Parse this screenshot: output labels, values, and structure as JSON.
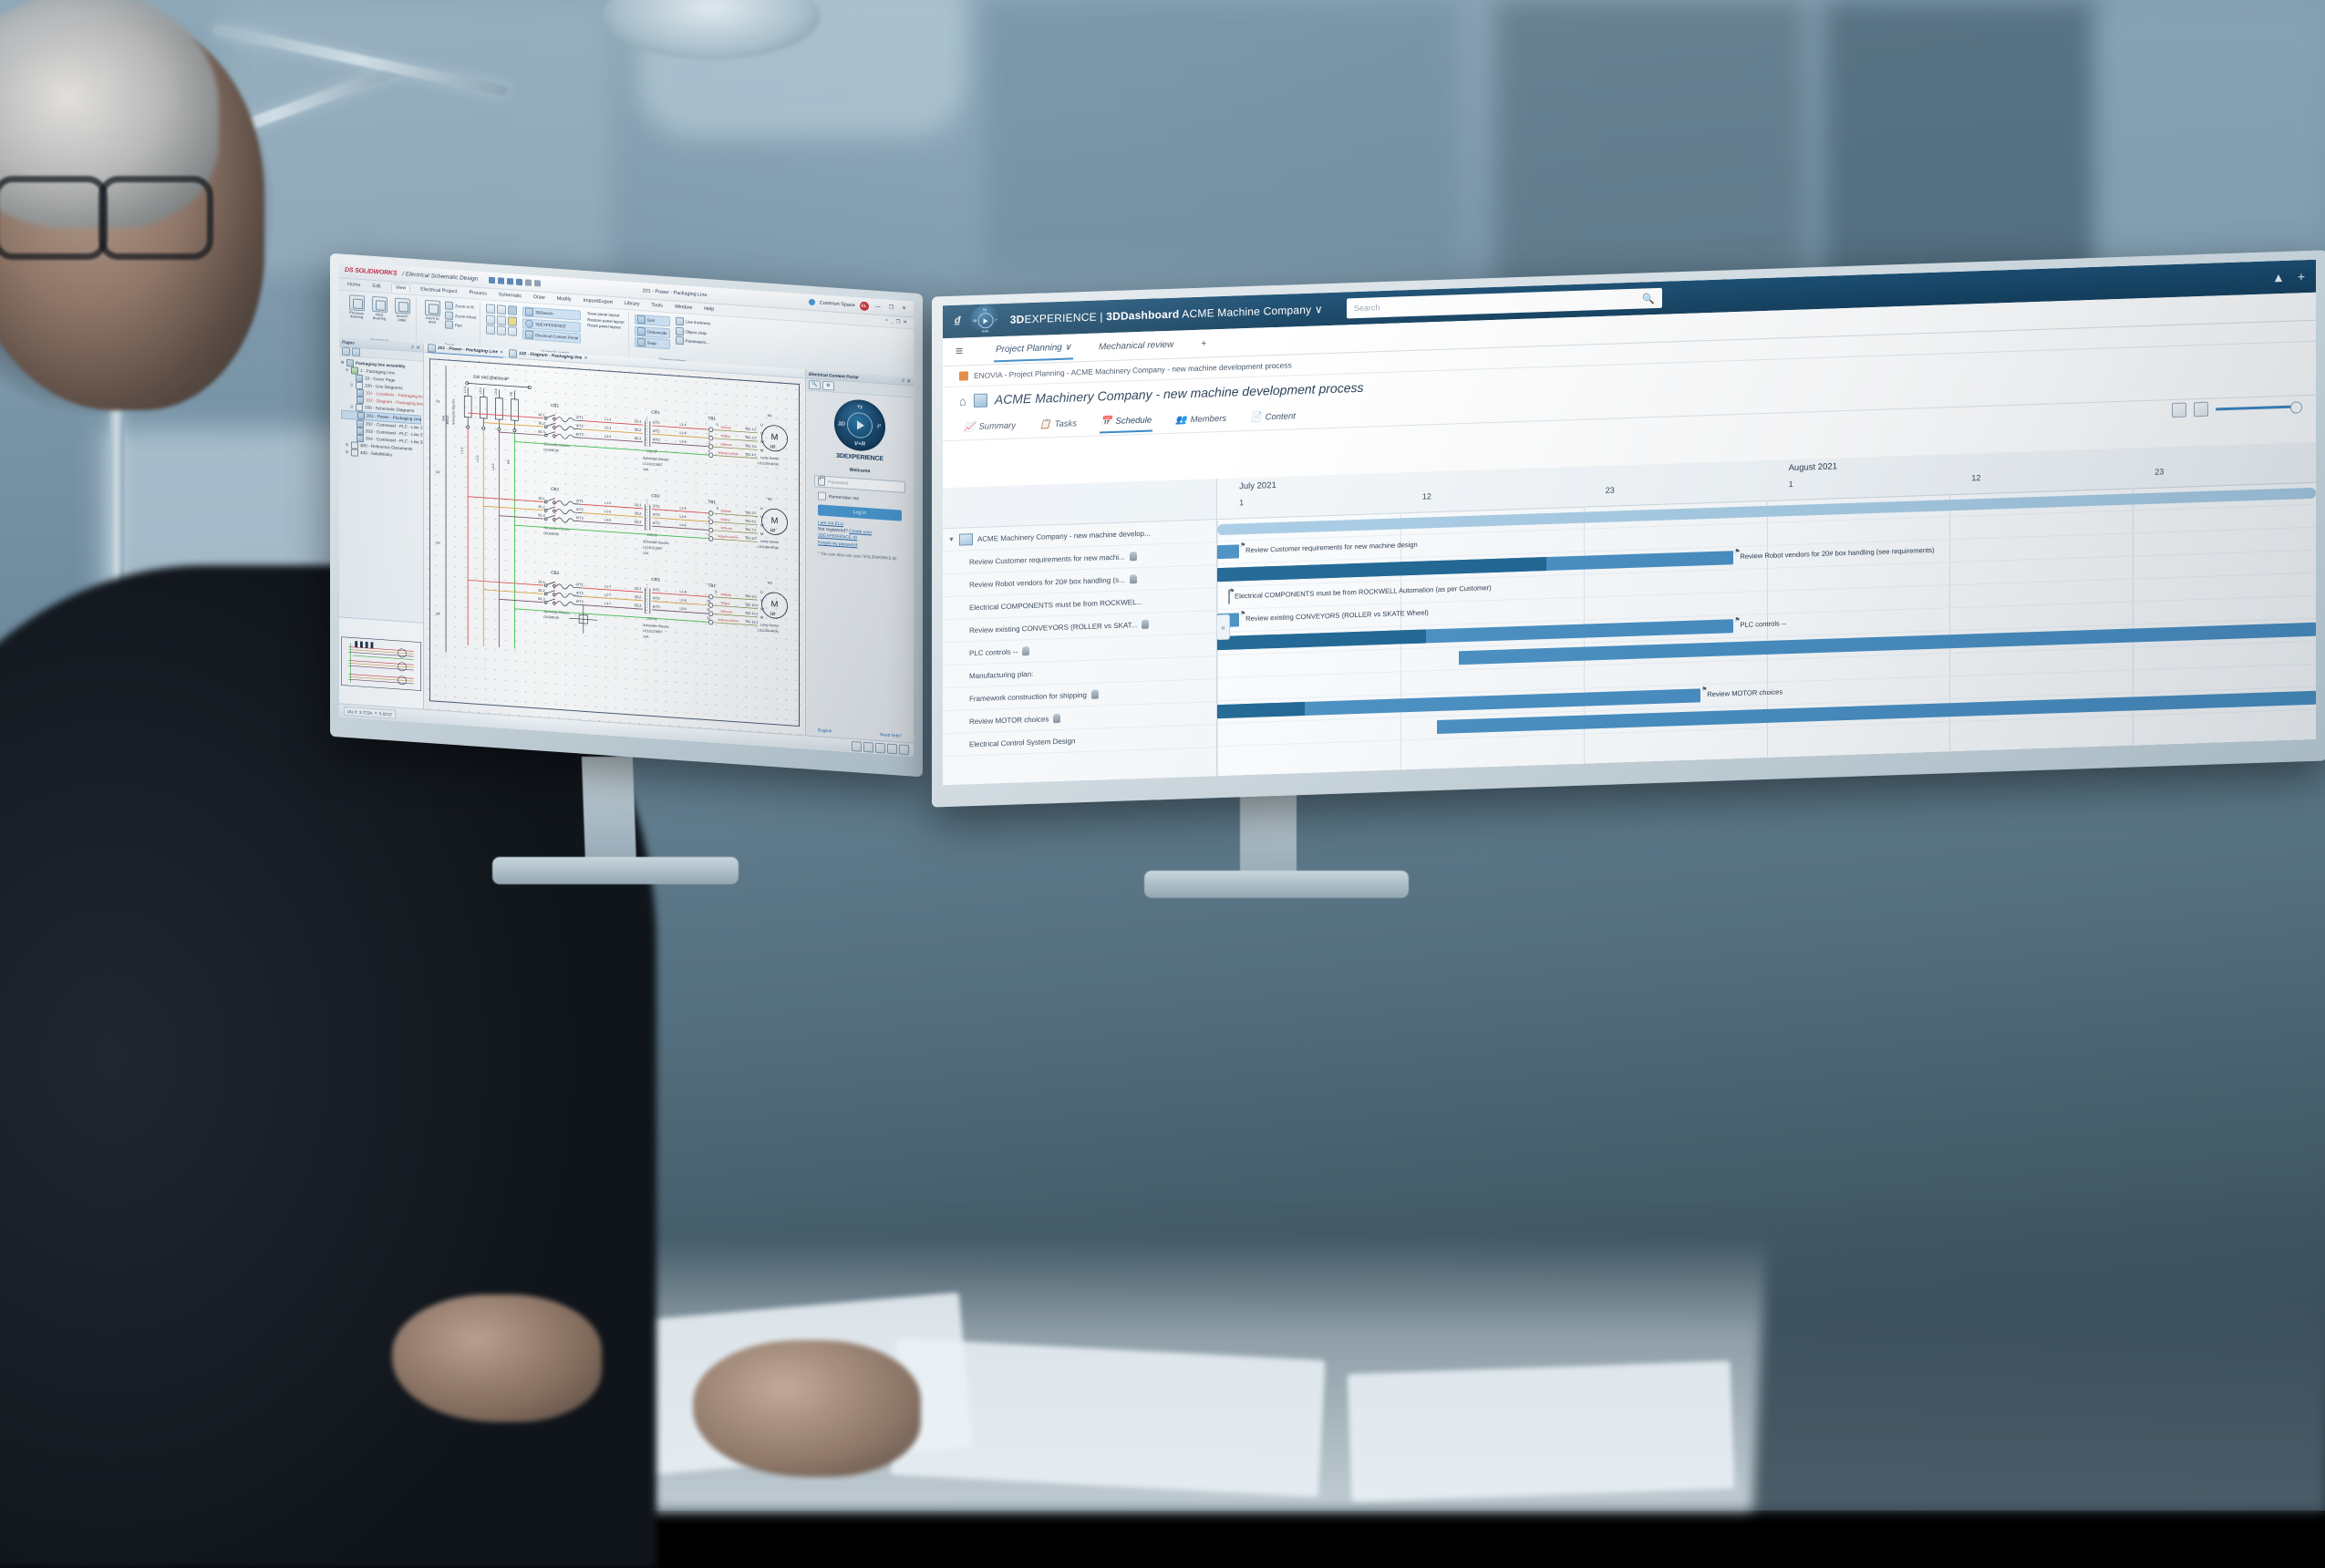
{
  "solidworks": {
    "brand": "SOLIDWORKS",
    "brand_mark": "DS",
    "product": "Electrical Schematic Design",
    "document_title": "201 - Power - Packaging Line",
    "common_space": "Common Space",
    "avatar_initials": "EL",
    "window_buttons": [
      "—",
      "❐",
      "✕"
    ],
    "menu": [
      "Home",
      "Edit",
      "View",
      "Electrical Project",
      "Process",
      "Schematic",
      "Draw",
      "Modify",
      "Import/Export",
      "Library",
      "Tools",
      "Window",
      "Help"
    ],
    "menu_active": "View",
    "ribbon_groups": [
      {
        "label": "Navigation",
        "big_buttons": [
          {
            "icon": "previous-drawing-icon",
            "line1": "Previous",
            "line2": "drawing"
          },
          {
            "icon": "next-drawing-icon",
            "line1": "Next",
            "line2": "drawing"
          },
          {
            "icon": "search-page-icon",
            "line1": "Search",
            "line2": "page"
          }
        ]
      },
      {
        "label": "Zoom",
        "big_buttons": [
          {
            "icon": "zoom-to-area-icon",
            "line1": "Zoom to",
            "line2": "area"
          }
        ],
        "small_buttons": [
          {
            "icon": "zoom-fit-icon",
            "label": "Zoom to fit"
          },
          {
            "icon": "zoom-inout-icon",
            "label": "Zoom in/out"
          },
          {
            "icon": "pan-icon",
            "label": "Pan"
          }
        ]
      },
      {
        "label": "Dockable panels",
        "toggle_icons": [
          "panel-1-icon",
          "panel-2-icon",
          "panel-3-icon",
          "panel-4-icon",
          "panel-5-icon",
          "panel-6-icon",
          "link-icon",
          "favorite-icon",
          "report-icon"
        ],
        "small_buttons": [
          {
            "icon": "search-icon",
            "label": "3DSearch",
            "highlight": true
          },
          {
            "icon": "globe-icon",
            "label": "3DEXPERIENCE",
            "highlight": true
          },
          {
            "icon": "portal-icon",
            "label": "Electrical Content Portal",
            "highlight": true
          }
        ],
        "text_buttons": [
          "Save panel layout",
          "Restore panel layout",
          "Reset panel layout"
        ]
      },
      {
        "label": "Drawing options",
        "small_buttons": [
          {
            "icon": "grid-icon",
            "label": "Grid",
            "highlight": true
          },
          {
            "icon": "orthomode-icon",
            "label": "Orthomode",
            "highlight": true
          },
          {
            "icon": "snap-icon",
            "label": "Snap",
            "highlight": true
          },
          {
            "icon": "line-thickness-icon",
            "label": "Line thickness"
          },
          {
            "icon": "object-snap-icon",
            "label": "Object snap"
          },
          {
            "icon": "parameters-icon",
            "label": "Parameters..."
          }
        ]
      }
    ],
    "pages_panel": {
      "title": "Pages",
      "pin_buttons": "⌷ ✕",
      "tree": [
        {
          "depth": 0,
          "expander": "⊟",
          "icon": "assembly-icon",
          "label": "Packaging line assembly",
          "style": "bold"
        },
        {
          "depth": 1,
          "expander": "⊟",
          "icon": "book-icon",
          "label": "1 - Packaging Line",
          "style": "normal"
        },
        {
          "depth": 2,
          "expander": "",
          "icon": "page-icon",
          "label": "10 - Cover Page",
          "style": "normal"
        },
        {
          "depth": 2,
          "expander": "⊟",
          "icon": "folder-icon",
          "label": "100 - Line Diagrams",
          "style": "normal"
        },
        {
          "depth": 3,
          "expander": "",
          "icon": "page-icon",
          "label": "101 - Locations - Packaging line",
          "style": "red"
        },
        {
          "depth": 3,
          "expander": "",
          "icon": "page-icon",
          "label": "102 - Diagram - Packaging line",
          "style": "red"
        },
        {
          "depth": 2,
          "expander": "⊟",
          "icon": "folder-icon",
          "label": "200 - Schematic Diagrams",
          "style": "normal"
        },
        {
          "depth": 3,
          "expander": "",
          "icon": "page-icon",
          "label": "201 - Power - Packaging Line",
          "style": "selected"
        },
        {
          "depth": 3,
          "expander": "",
          "icon": "page-icon",
          "label": "202 - Command - PLC - Line 1",
          "style": "normal"
        },
        {
          "depth": 3,
          "expander": "",
          "icon": "page-icon",
          "label": "203 - Command - PLC - Line 2",
          "style": "normal"
        },
        {
          "depth": 3,
          "expander": "",
          "icon": "page-icon",
          "label": "204 - Command - PLC - Line 3",
          "style": "normal"
        },
        {
          "depth": 1,
          "expander": "⊞",
          "icon": "folder-icon",
          "label": "300 - Reference Documents",
          "style": "normal"
        },
        {
          "depth": 1,
          "expander": "⊞",
          "icon": "folder-icon",
          "label": "400 - SolidWorks",
          "style": "normal"
        }
      ]
    },
    "document_tabs": [
      {
        "label": "201 - Power - Packaging Line",
        "active": true,
        "close": "✕"
      },
      {
        "label": "102 - Diagram - Packaging line",
        "active": false,
        "close": "✕"
      }
    ],
    "status_bar": {
      "coordinates": "(A) X: 3.7234, Y: 5.0212",
      "icons": [
        "grid-status-icon",
        "ortho-status-icon",
        "snap-status-icon",
        "thickness-status-icon",
        "osnap-status-icon"
      ]
    },
    "content_portal": {
      "title": "Electrical Content Portal",
      "pin_buttons": "⌷ ✕",
      "tabs": [
        "search-tab-icon",
        "portal-tab-icon"
      ],
      "logo_text_bold": "3D",
      "logo_text": "EXPERIENCE",
      "compass": {
        "left": "3D",
        "right": "i²",
        "top": "Yɣ",
        "bottom": "V+R"
      },
      "welcome": "Welcome",
      "password_placeholder": "Password",
      "remember_label": "Remember me",
      "login_label": "Log in",
      "not_user_link": "I am not ELU",
      "not_registered_text": "Not registered?",
      "create_id_link": "Create your 3DEXPERIENCE ID",
      "forgot_link": "Forgot my password",
      "footnote": "* You can also use your SOLIDWORKS ID",
      "language": "English",
      "help_link": "Need help?"
    },
    "schematic": {
      "supply_label": "230 VAC@60Hz3P",
      "main_breaker": {
        "maker": "Schneider Electric",
        "rating": "50A",
        "part": "49002"
      },
      "phases": [
        "L1-2",
        "L2-2",
        "L3-2",
        "PE"
      ],
      "branches": [
        {
          "breaker_tag": "CB1",
          "breaker_maker": "Schneider Electric",
          "breaker_part": "GV2ME06",
          "contactor_tag": "CR1",
          "contactor_ref": "203-07",
          "contactor_maker": "Schneider Electric",
          "contactor_part": "LC1D1210B7",
          "contactor_rating": "12A",
          "terminal": "TB1",
          "terminal_numbers": [
            "1",
            "2",
            "3",
            "4"
          ],
          "wires_in": [
            "L1-3",
            "L2-3",
            "L3-3"
          ],
          "wires_out": [
            "L1-4",
            "L2-4",
            "L3-4"
          ],
          "wire_colors": [
            "W/black",
            "W/grey",
            "W/brown",
            "W/green-yellow"
          ],
          "terminal_refs": [
            "TB1 1:2",
            "TB1 2:2",
            "TB1 3:2",
            "TB1 4:2"
          ],
          "motor_tag": "M1",
          "motor_symbol": "M",
          "motor_phase": "3Ø",
          "motor_maker": "Leroy Somer",
          "motor_part": "LS112M-4P(4)",
          "motor_terminals": [
            "U",
            "V",
            "W",
            "M"
          ]
        },
        {
          "breaker_tag": "CB2",
          "breaker_maker": "Schneider Electric",
          "breaker_part": "GV2ME08",
          "contactor_tag": "CR2",
          "contactor_ref": "203-09",
          "contactor_maker": "Schneider Electric",
          "contactor_part": "LC1D1210B7",
          "contactor_rating": "12A",
          "terminal": "TB1",
          "terminal_numbers": [
            "5",
            "6",
            "7",
            "8"
          ],
          "wires_in": [
            "L1-5",
            "L2-5",
            "L3-5"
          ],
          "wires_out": [
            "L1-6",
            "L2-6",
            "L3-6"
          ],
          "wire_colors": [
            "W/black",
            "W/grey",
            "W/brown",
            "W/green-yellow"
          ],
          "terminal_refs": [
            "TB1 5:2",
            "TB1 6:2",
            "TB1 7:2",
            "TB1 8:2"
          ],
          "motor_tag": "M2",
          "motor_symbol": "M",
          "motor_phase": "3Ø",
          "motor_maker": "Leroy Somer",
          "motor_part": "LS112M-4P(4)",
          "motor_terminals": [
            "U",
            "V",
            "W",
            "M"
          ]
        },
        {
          "breaker_tag": "CB3",
          "breaker_maker": "Schneider Electric",
          "breaker_part": "GV2ME08",
          "contactor_tag": "CR3",
          "contactor_ref": "203-11",
          "contactor_maker": "Schneider Electric",
          "contactor_part": "LC1D1210B7",
          "contactor_rating": "12A",
          "terminal": "TB1",
          "terminal_numbers": [
            "9",
            "10",
            "11",
            "12"
          ],
          "wires_in": [
            "L1-7",
            "L2-7",
            "L3-7"
          ],
          "wires_out": [
            "L1-8",
            "L2-8",
            "L3-8"
          ],
          "wire_colors": [
            "W/black",
            "W/grey",
            "W/brown",
            "W/green-yellow"
          ],
          "terminal_refs": [
            "TB1 9:2",
            "TB1 10:2",
            "TB1 11:2",
            "TB1 12:2"
          ],
          "motor_tag": "M3",
          "motor_symbol": "M",
          "motor_phase": "3Ø",
          "motor_maker": "Leroy Somer",
          "motor_part": "LS112M-4P(4)",
          "motor_terminals": [
            "U",
            "V",
            "W",
            "M"
          ]
        }
      ],
      "contact_labels": [
        "1/L1",
        "3/L2",
        "5/L3",
        "2/T1",
        "4/T2",
        "6/T3"
      ],
      "row_marks": [
        "01",
        "02",
        "03",
        "04"
      ]
    }
  },
  "dashboard": {
    "brand_prefix": "3D",
    "brand": "EXPERIENCE",
    "app": "3DDashboard",
    "tenant": "ACME Machine Company",
    "tenant_caret": "∨",
    "search_placeholder": "Search",
    "dashboard_tabs": [
      {
        "label": "Project Planning",
        "caret": "∨",
        "active": true
      },
      {
        "label": "Mechanical review",
        "caret": "",
        "active": false
      }
    ],
    "add_tab": "+",
    "breadcrumb": "ENOVIA - Project Planning - ACME Machinery Company - new machine development process",
    "page_title": "ACME Machinery Company - new machine development process",
    "object_tabs": [
      {
        "label": "Summary",
        "icon": "chart-icon",
        "active": false
      },
      {
        "label": "Tasks",
        "icon": "clipboard-icon",
        "active": false
      },
      {
        "label": "Schedule",
        "icon": "calendar-icon",
        "active": true
      },
      {
        "label": "Members",
        "icon": "people-icon",
        "active": false
      },
      {
        "label": "Content",
        "icon": "document-icon",
        "active": false
      }
    ],
    "toolbar": {
      "fit_button": "fit-to-window-icon",
      "expand_button": "expand-icon",
      "zoom_slider_value": 100
    },
    "gantt_chart": {
      "type": "gantt",
      "timeline": {
        "months": [
          "July 2021",
          "August 2021"
        ],
        "day_ticks": [
          "1",
          "12",
          "23",
          "1",
          "12",
          "23"
        ],
        "start": "2021-07-01",
        "end": "2021-09-01"
      },
      "rows": [
        {
          "name": "ACME Machinery Company - new machine develop...",
          "full_name": "ACME Machinery Company - new machine development process",
          "type": "summary",
          "indent": 0,
          "expander": "▼",
          "has_owner": false,
          "bar_start_pct": 0,
          "bar_end_pct": 100,
          "progress_pct": 0,
          "bar_label": ""
        },
        {
          "name": "Review Customer requirements for new machi...",
          "full_name": "Review Customer requirements for new machine design",
          "type": "task",
          "indent": 1,
          "expander": "",
          "has_owner": true,
          "bar_start_pct": 0,
          "bar_end_pct": 2,
          "progress_pct": 0,
          "bar_label": "Review Customer requirements for new machine design"
        },
        {
          "name": "Review Robot vendors for 20# box handling (s...",
          "full_name": "Review Robot vendors for 20# box handling (see requirements)",
          "type": "task",
          "indent": 1,
          "expander": "",
          "has_owner": true,
          "bar_start_pct": 0,
          "bar_end_pct": 47,
          "progress_pct": 30,
          "bar_label": "Review Robot vendors for 20# box handling (see requirements)"
        },
        {
          "name": "Electrical COMPONENTS must be from ROCKWEL...",
          "full_name": "Electrical COMPONENTS must be from ROCKWELL Automation (as per Customer)",
          "type": "milestone",
          "indent": 1,
          "expander": "",
          "has_owner": false,
          "bar_start_pct": 1,
          "bar_end_pct": 1,
          "progress_pct": 0,
          "bar_label": "Electrical COMPONENTS must be from ROCKWELL Automation (as per Customer)"
        },
        {
          "name": "Review existing CONVEYORS (ROLLER vs SKAT...",
          "full_name": "Review existing CONVEYORS (ROLLER vs SKATE Wheel)",
          "type": "task",
          "indent": 1,
          "expander": "",
          "has_owner": true,
          "bar_start_pct": 0,
          "bar_end_pct": 2,
          "progress_pct": 0,
          "bar_label": "Review existing CONVEYORS (ROLLER vs SKATE Wheel)"
        },
        {
          "name": "PLC controls --",
          "full_name": "PLC controls --",
          "type": "task",
          "indent": 1,
          "expander": "",
          "has_owner": true,
          "bar_start_pct": 0,
          "bar_end_pct": 47,
          "progress_pct": 19,
          "bar_label": "PLC controls --"
        },
        {
          "name": "Manufacturing plan:",
          "full_name": "Manufacturing plan:",
          "type": "task",
          "indent": 1,
          "expander": "",
          "has_owner": false,
          "bar_start_pct": 22,
          "bar_end_pct": 100,
          "progress_pct": 0,
          "bar_label": ""
        },
        {
          "name": "Framework construction for shipping",
          "full_name": "Framework construction for shipping",
          "type": "task",
          "indent": 1,
          "expander": "",
          "has_owner": true,
          "bar_start_pct": 0,
          "bar_end_pct": 0,
          "progress_pct": 0,
          "bar_label": ""
        },
        {
          "name": "Review MOTOR choices",
          "full_name": "Review MOTOR choices",
          "type": "task",
          "indent": 1,
          "expander": "",
          "has_owner": true,
          "bar_start_pct": 0,
          "bar_end_pct": 44,
          "progress_pct": 8,
          "bar_label": "Review MOTOR choices"
        },
        {
          "name": "Electrical Control System Design",
          "full_name": "Electrical Control System Design",
          "type": "task",
          "indent": 1,
          "expander": "",
          "has_owner": false,
          "bar_start_pct": 20,
          "bar_end_pct": 100,
          "progress_pct": 0,
          "bar_label": ""
        }
      ]
    }
  }
}
